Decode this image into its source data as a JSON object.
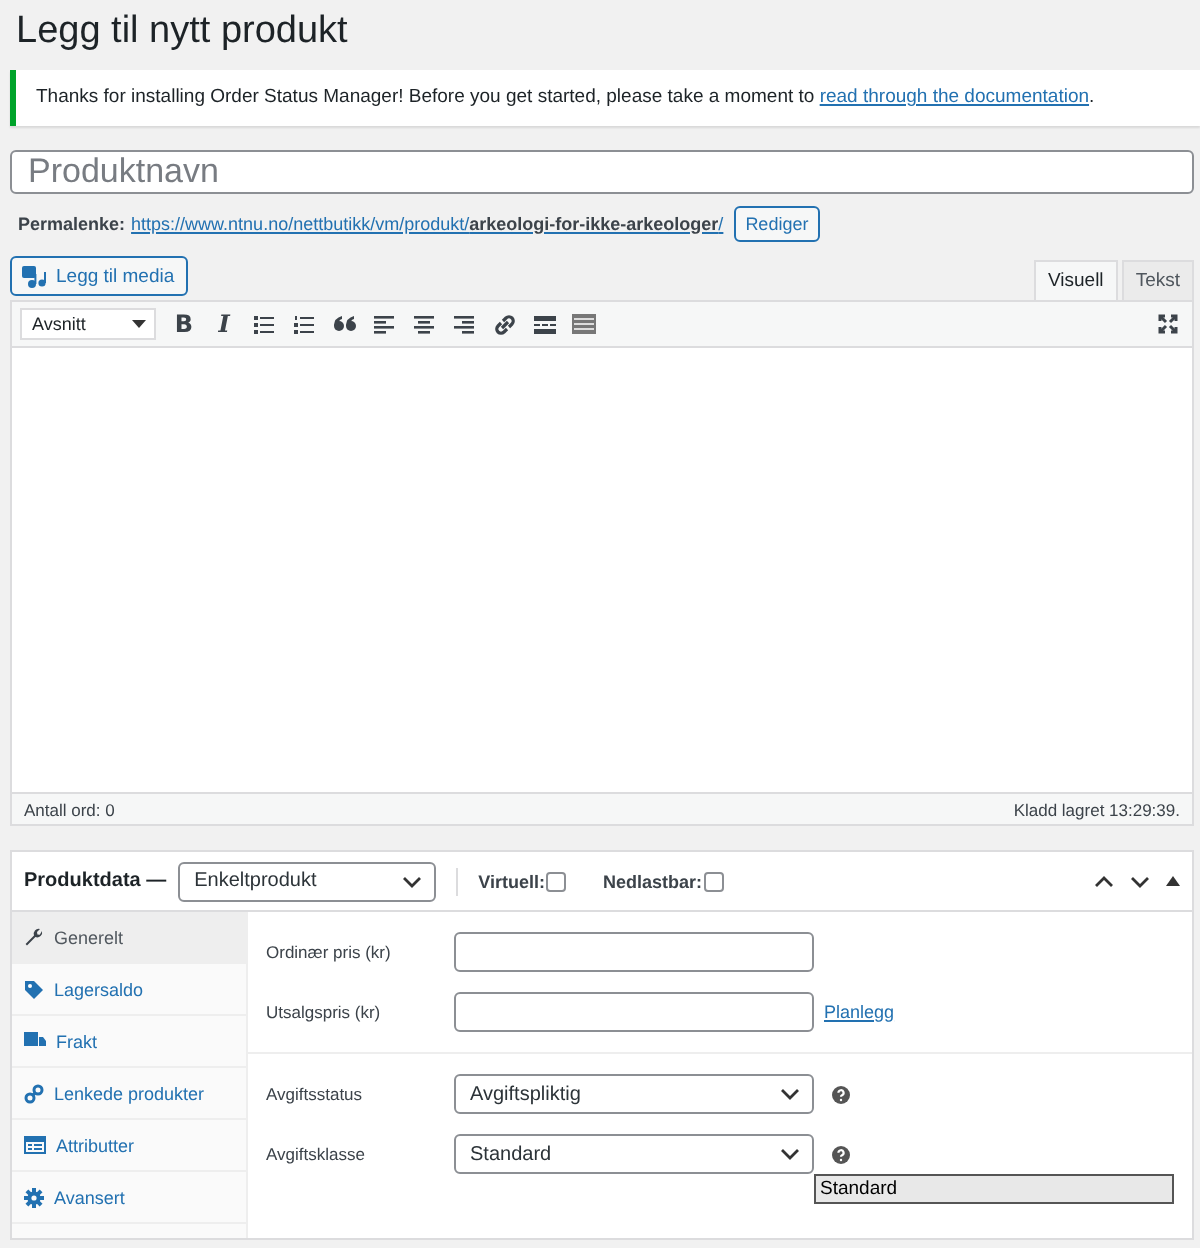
{
  "page": {
    "title": "Legg til nytt produkt"
  },
  "notice": {
    "text": "Thanks for installing Order Status Manager! Before you get started, please take a moment to ",
    "link": "read through the documentation",
    "end": "."
  },
  "title_field": {
    "placeholder": "Produktnavn"
  },
  "permalink": {
    "label": "Permalenke:",
    "url": "https://www.ntnu.no/nettbutikk/vm/produkt/**arkeologi-for-ikke-arkeologer**/",
    "button": "Rediger"
  },
  "editor": {
    "add_media": "Legg til media",
    "tabs": [
      {
        "label": "Visuell",
        "selected": true
      },
      {
        "label": "Tekst",
        "selected": false
      }
    ],
    "format": "Avsnitt",
    "toolbar": [
      {
        "kind": "text",
        "glyph": "B"
      },
      {
        "kind": "text",
        "glyph": "I"
      },
      {
        "kind": "bullets"
      },
      {
        "kind": "numbers"
      },
      {
        "kind": "quote"
      },
      {
        "kind": "left"
      },
      {
        "kind": "center"
      },
      {
        "kind": "right"
      },
      {
        "kind": "link"
      },
      {
        "kind": "more"
      },
      {
        "kind": "kitchen"
      }
    ],
    "word_count": "Antall ord: 0",
    "saved": "Kladd lagret 13:29:39."
  },
  "product_data": {
    "label": "Produktdata —",
    "type": "Enkeltprodukt",
    "options": [
      {
        "label": "Virtuell:",
        "checked": false
      },
      {
        "label": "Nedlastbar:",
        "checked": false
      }
    ],
    "tabs": [
      {
        "label": "Generelt",
        "kind": "wrench",
        "selected": true
      },
      {
        "label": "Lagersaldo",
        "kind": "tag",
        "selected": false
      },
      {
        "label": "Frakt",
        "kind": "truck",
        "selected": false
      },
      {
        "label": "Lenkede produkter",
        "kind": "link",
        "selected": false
      },
      {
        "label": "Attributter",
        "kind": "table",
        "selected": false
      },
      {
        "label": "Avansert",
        "kind": "gear",
        "selected": false
      }
    ],
    "price_fields": [
      {
        "label": "Ordinær pris (kr)"
      },
      {
        "label": "Utsalgspris (kr)",
        "link": "Planlegg"
      }
    ],
    "tax_fields": [
      {
        "label": "Avgiftsstatus",
        "value": "Avgiftspliktig"
      },
      {
        "label": "Avgiftsklasse",
        "value": "Standard"
      }
    ],
    "open_dropdown": [
      {
        "label": "Standard",
        "selected": true
      }
    ]
  }
}
